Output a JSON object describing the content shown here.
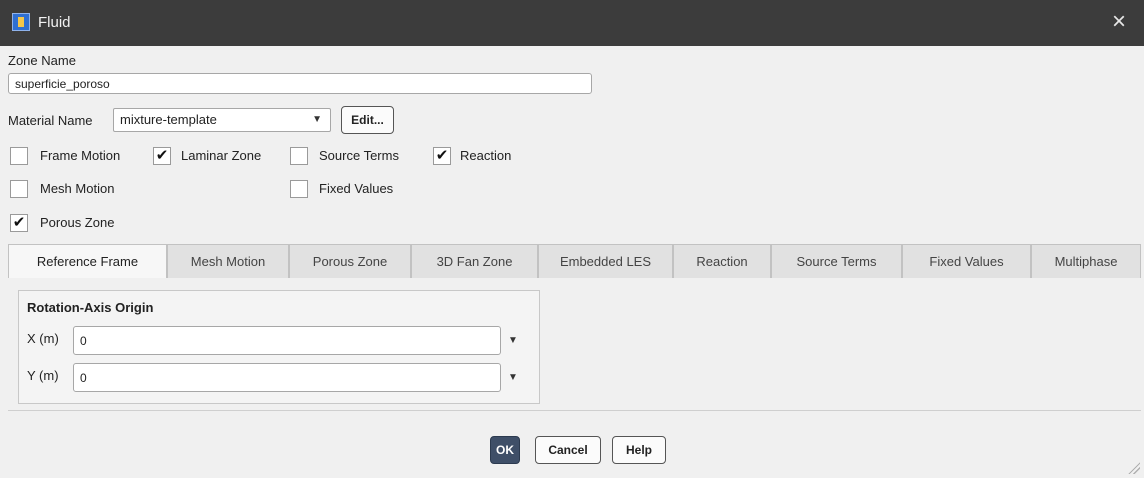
{
  "window": {
    "title": "Fluid",
    "close_icon": "×"
  },
  "zone": {
    "label": "Zone Name",
    "value": "superficie_poroso"
  },
  "material": {
    "label": "Material Name",
    "value": "mixture-template",
    "arrow": "▼",
    "edit_label": "Edit..."
  },
  "checkboxes": [
    {
      "label": "Frame Motion",
      "checked": false
    },
    {
      "label": "Laminar Zone",
      "checked": true
    },
    {
      "label": "Source Terms",
      "checked": false
    },
    {
      "label": "Reaction",
      "checked": true
    },
    {
      "label": "Mesh Motion",
      "checked": false
    },
    {
      "label": "Fixed Values",
      "checked": false
    },
    {
      "label": "Porous Zone",
      "checked": true
    }
  ],
  "check_mark": "✔",
  "tabs": [
    {
      "label": "Reference Frame",
      "active": true
    },
    {
      "label": "Mesh Motion",
      "active": false
    },
    {
      "label": "Porous Zone",
      "active": false
    },
    {
      "label": "3D Fan Zone",
      "active": false
    },
    {
      "label": "Embedded LES",
      "active": false
    },
    {
      "label": "Reaction",
      "active": false
    },
    {
      "label": "Source Terms",
      "active": false
    },
    {
      "label": "Fixed Values",
      "active": false
    },
    {
      "label": "Multiphase",
      "active": false
    }
  ],
  "rotation_axis": {
    "title": "Rotation-Axis Origin",
    "x": {
      "label": "X (m)",
      "value": "0"
    },
    "y": {
      "label": "Y (m)",
      "value": "0"
    },
    "dropdown_arrow": "▼"
  },
  "buttons": {
    "ok": "OK",
    "cancel": "Cancel",
    "help": "Help"
  },
  "colors": {
    "titlebar": "#3c3c3c",
    "ok_button": "#3f4f68"
  }
}
